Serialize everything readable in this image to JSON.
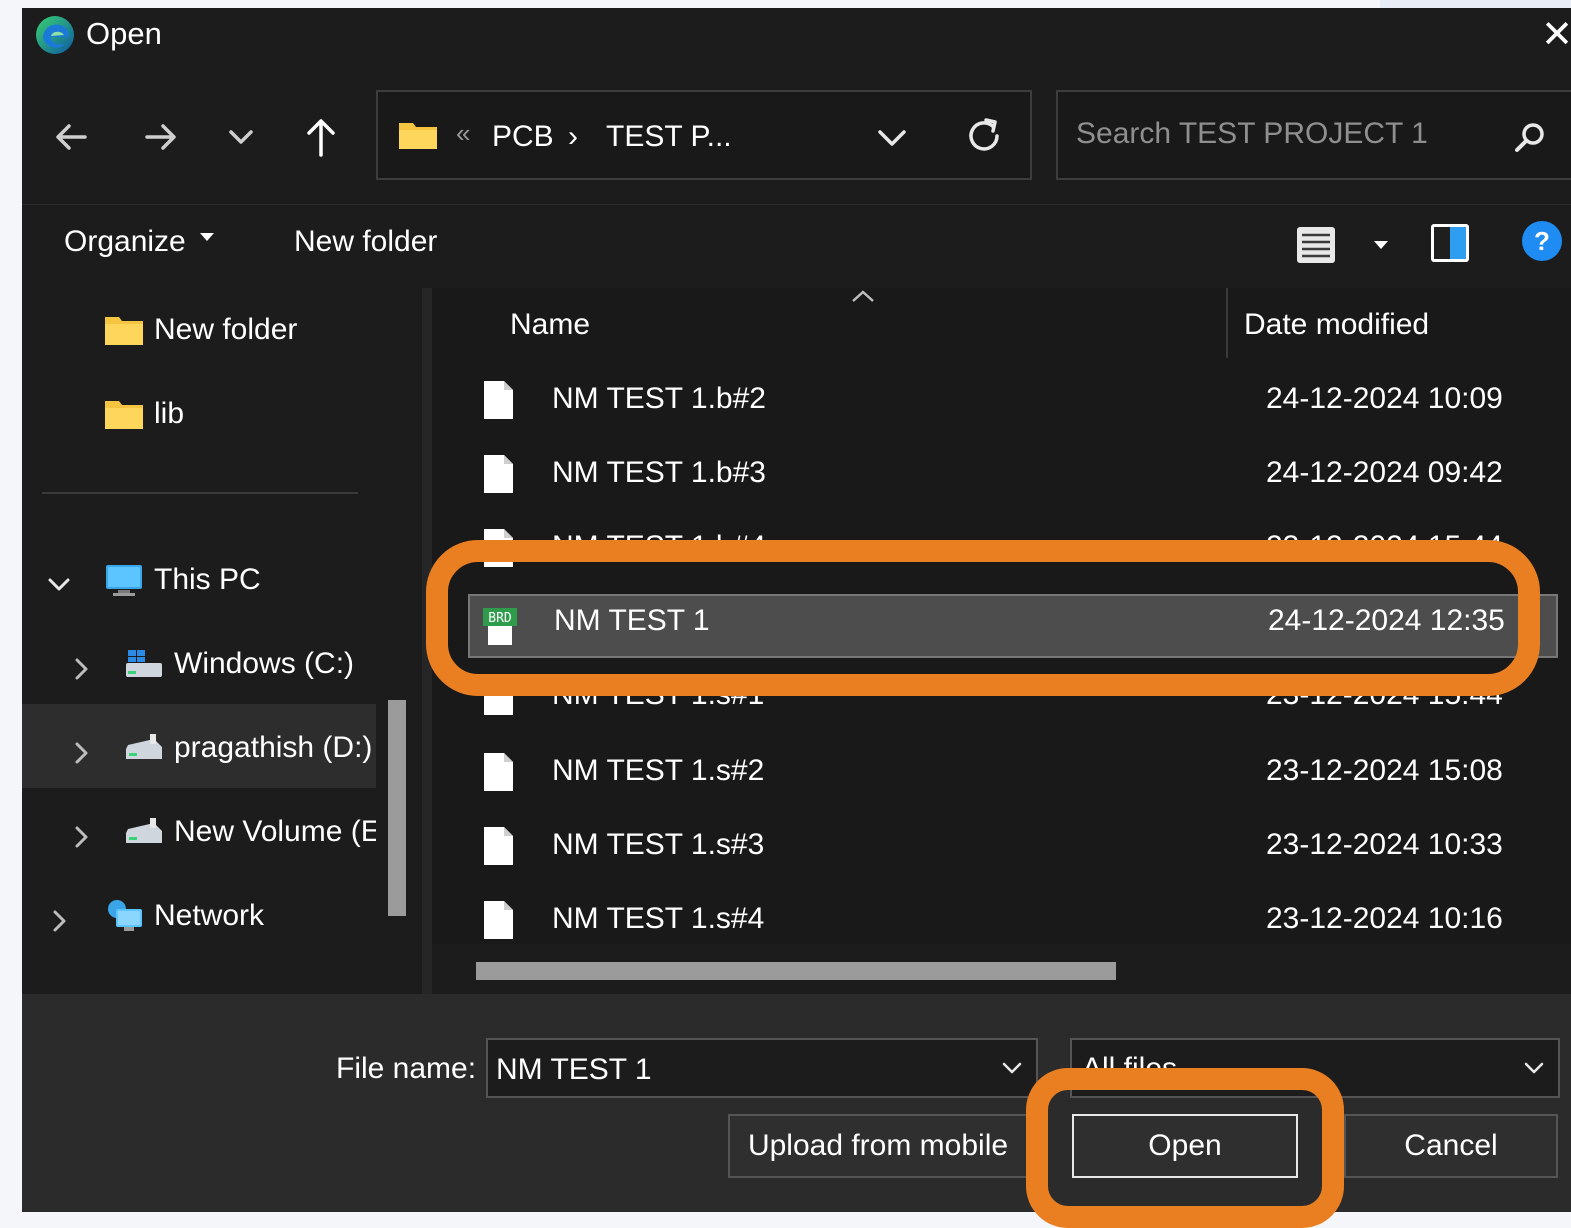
{
  "window": {
    "title": "Open",
    "close_symbol": "✕"
  },
  "address_bar": {
    "overflow": "«",
    "crumbs": [
      "PCB",
      "TEST P..."
    ],
    "separator": "›"
  },
  "search": {
    "placeholder": "Search TEST PROJECT 1"
  },
  "toolbar": {
    "organize_label": "Organize",
    "new_folder_label": "New folder"
  },
  "sidebar": {
    "items": [
      {
        "label": "New folder",
        "icon": "folder-icon"
      },
      {
        "label": "lib",
        "icon": "folder-icon"
      },
      {
        "label": "This PC",
        "icon": "computer-icon",
        "expanded": true
      },
      {
        "label": "Windows (C:)",
        "icon": "drive-windows-icon"
      },
      {
        "label": "pragathish (D:)",
        "icon": "drive-icon",
        "hovered": true
      },
      {
        "label": "New Volume (E",
        "icon": "drive-icon"
      },
      {
        "label": "Network",
        "icon": "network-icon"
      }
    ]
  },
  "columns": {
    "name": "Name",
    "date": "Date modified"
  },
  "files": [
    {
      "name": "NM TEST 1.b#2",
      "date": "24-12-2024 10:09"
    },
    {
      "name": "NM TEST 1.b#3",
      "date": "24-12-2024 09:42"
    },
    {
      "name": "NM TEST 1.b#4",
      "date": "23-12-2024 15:44"
    },
    {
      "name": "NM TEST 1",
      "date": "24-12-2024 12:35",
      "selected": true,
      "icon": "brd-file-icon",
      "icon_text": "BRD"
    },
    {
      "name": "NM TEST 1.s#1",
      "date": "23-12-2024 15:44"
    },
    {
      "name": "NM TEST 1.s#2",
      "date": "23-12-2024 15:08"
    },
    {
      "name": "NM TEST 1.s#3",
      "date": "23-12-2024 10:33"
    },
    {
      "name": "NM TEST 1.s#4",
      "date": "23-12-2024 10:16"
    }
  ],
  "footer": {
    "file_name_label": "File name:",
    "file_name_value": "NM TEST 1",
    "file_type_value": "All files",
    "upload_label": "Upload from mobile",
    "open_label": "Open",
    "cancel_label": "Cancel"
  },
  "colors": {
    "highlight": "#ea7f22",
    "dialog_bg": "#1f1f1f",
    "selected_row": "#4d4d4d"
  }
}
